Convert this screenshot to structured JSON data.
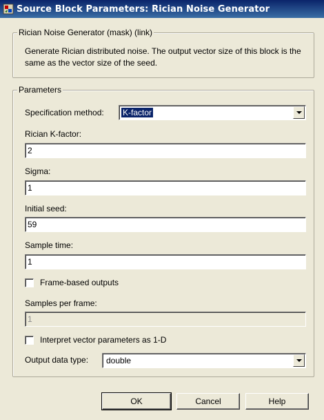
{
  "window": {
    "title": "Source Block Parameters: Rician Noise Generator",
    "close_glyph": "✕",
    "icon": "simulink-block-icon"
  },
  "mask_group": {
    "title": "Rician Noise Generator (mask) (link)",
    "description": "Generate Rician distributed noise. The output vector size of this block is the same as the vector size of the seed."
  },
  "params_group": {
    "title": "Parameters",
    "spec_method_label": "Specification method:",
    "spec_method_value": "K-factor",
    "k_factor_label": "Rician K-factor:",
    "k_factor_value": "2",
    "sigma_label": "Sigma:",
    "sigma_value": "1",
    "seed_label": "Initial seed:",
    "seed_value": "59",
    "sample_time_label": "Sample time:",
    "sample_time_value": "1",
    "frame_based_label": "Frame-based outputs",
    "frame_based_checked": false,
    "samples_per_frame_label": "Samples per frame:",
    "samples_per_frame_value": "1",
    "interpret_label": "Interpret vector parameters as 1-D",
    "interpret_checked": false,
    "output_type_label": "Output data type:",
    "output_type_value": "double"
  },
  "buttons": {
    "ok": "OK",
    "cancel": "Cancel",
    "help": "Help"
  }
}
